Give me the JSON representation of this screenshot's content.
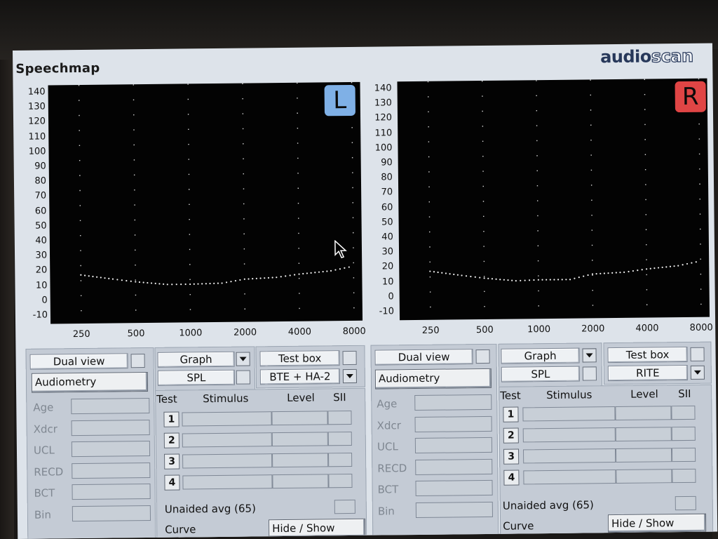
{
  "window": {
    "title": "Speechmap",
    "brand_a": "audio",
    "brand_b": "scan"
  },
  "chart_data": [
    {
      "type": "line",
      "ear": "L",
      "x": [
        250,
        375,
        500,
        750,
        1000,
        1500,
        2000,
        3000,
        4000,
        6000,
        8000
      ],
      "series": [
        {
          "values": [
            17,
            14,
            12,
            10,
            10,
            10.5,
            13,
            14,
            16,
            18,
            21
          ]
        }
      ],
      "y_ticks": [
        140,
        130,
        120,
        110,
        100,
        90,
        80,
        70,
        60,
        50,
        40,
        30,
        20,
        10,
        0,
        -10
      ],
      "x_ticks": [
        "250",
        "500",
        "1000",
        "2000",
        "4000",
        "8000"
      ],
      "ylim": [
        -10,
        140
      ],
      "x_scale": "log",
      "grid": "dotted"
    },
    {
      "type": "line",
      "ear": "R",
      "x": [
        250,
        375,
        500,
        750,
        1000,
        1500,
        2000,
        3000,
        4000,
        6000,
        8000
      ],
      "series": [
        {
          "values": [
            17,
            14,
            12,
            10,
            10.5,
            10.5,
            14,
            15,
            17,
            19,
            22
          ]
        }
      ],
      "y_ticks": [
        140,
        130,
        120,
        110,
        100,
        90,
        80,
        70,
        60,
        50,
        40,
        30,
        20,
        10,
        0,
        -10
      ],
      "x_ticks": [
        "250",
        "500",
        "1000",
        "2000",
        "4000",
        "8000"
      ],
      "ylim": [
        -10,
        140
      ],
      "x_scale": "log",
      "grid": "dotted"
    }
  ],
  "left": {
    "badge": "L",
    "badge_color": "#7fb0e6",
    "dual_view": "Dual view",
    "audiometry": "Audiometry",
    "fields": [
      "Age",
      "Xdcr",
      "UCL",
      "RECD",
      "BCT",
      "Bin"
    ],
    "graph": "Graph",
    "spl": "SPL",
    "test_box": "Test box",
    "instrument": "BTE + HA-2",
    "headers": {
      "test": "Test",
      "stimulus": "Stimulus",
      "level": "Level",
      "sii": "SII"
    },
    "tests": [
      "1",
      "2",
      "3",
      "4"
    ],
    "unaided": "Unaided avg (65)",
    "curve": "Curve",
    "hide_show": "Hide / Show"
  },
  "right": {
    "badge": "R",
    "badge_color": "#e04545",
    "dual_view": "Dual view",
    "audiometry": "Audiometry",
    "fields": [
      "Age",
      "Xdcr",
      "UCL",
      "RECD",
      "BCT",
      "Bin"
    ],
    "graph": "Graph",
    "spl": "SPL",
    "test_box": "Test box",
    "instrument": "RITE",
    "headers": {
      "test": "Test",
      "stimulus": "Stimulus",
      "level": "Level",
      "sii": "SII"
    },
    "tests": [
      "1",
      "2",
      "3",
      "4"
    ],
    "unaided": "Unaided avg (65)",
    "curve": "Curve",
    "hide_show": "Hide / Show"
  }
}
